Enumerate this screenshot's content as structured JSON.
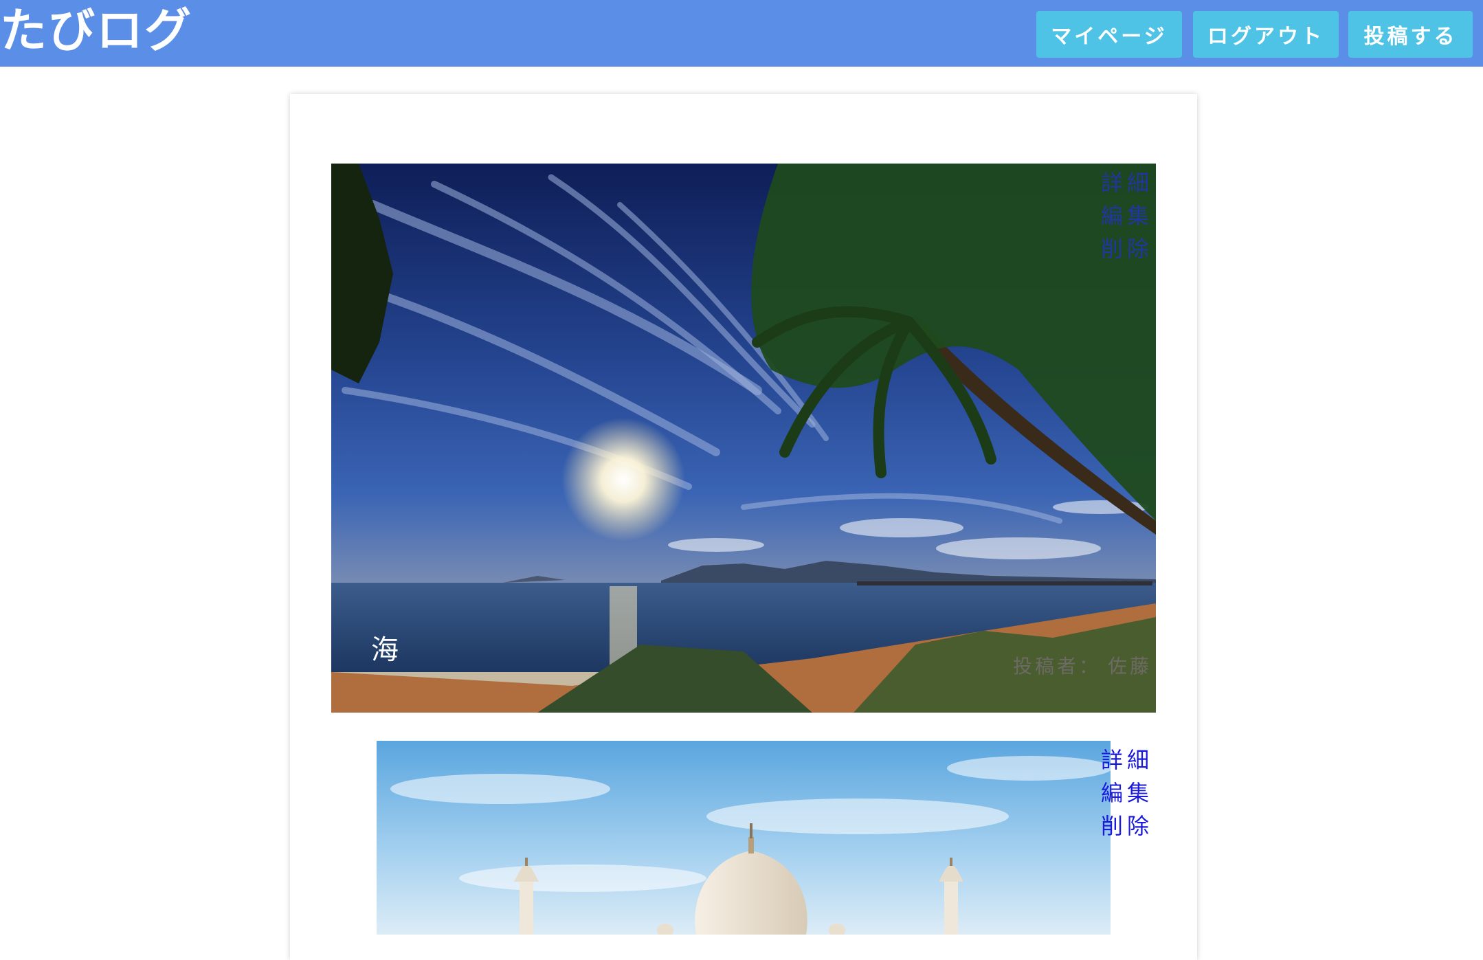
{
  "header": {
    "logo": "たびログ",
    "nav": {
      "mypage": "マイページ",
      "logout": "ログアウト",
      "post": "投稿する"
    }
  },
  "colors": {
    "header_bg": "#5b8ee7",
    "nav_button_bg": "#4fc3e6",
    "link": "#1a1adb"
  },
  "posts": [
    {
      "title": "海",
      "author_label": "投稿者：",
      "author": "佐藤",
      "image": "beach-sunset-palm-tree-photo",
      "actions": {
        "detail": "詳細",
        "edit": "編集",
        "delete": "削除"
      }
    },
    {
      "image": "taj-mahal-photo",
      "actions": {
        "detail": "詳細",
        "edit": "編集",
        "delete": "削除"
      }
    }
  ]
}
